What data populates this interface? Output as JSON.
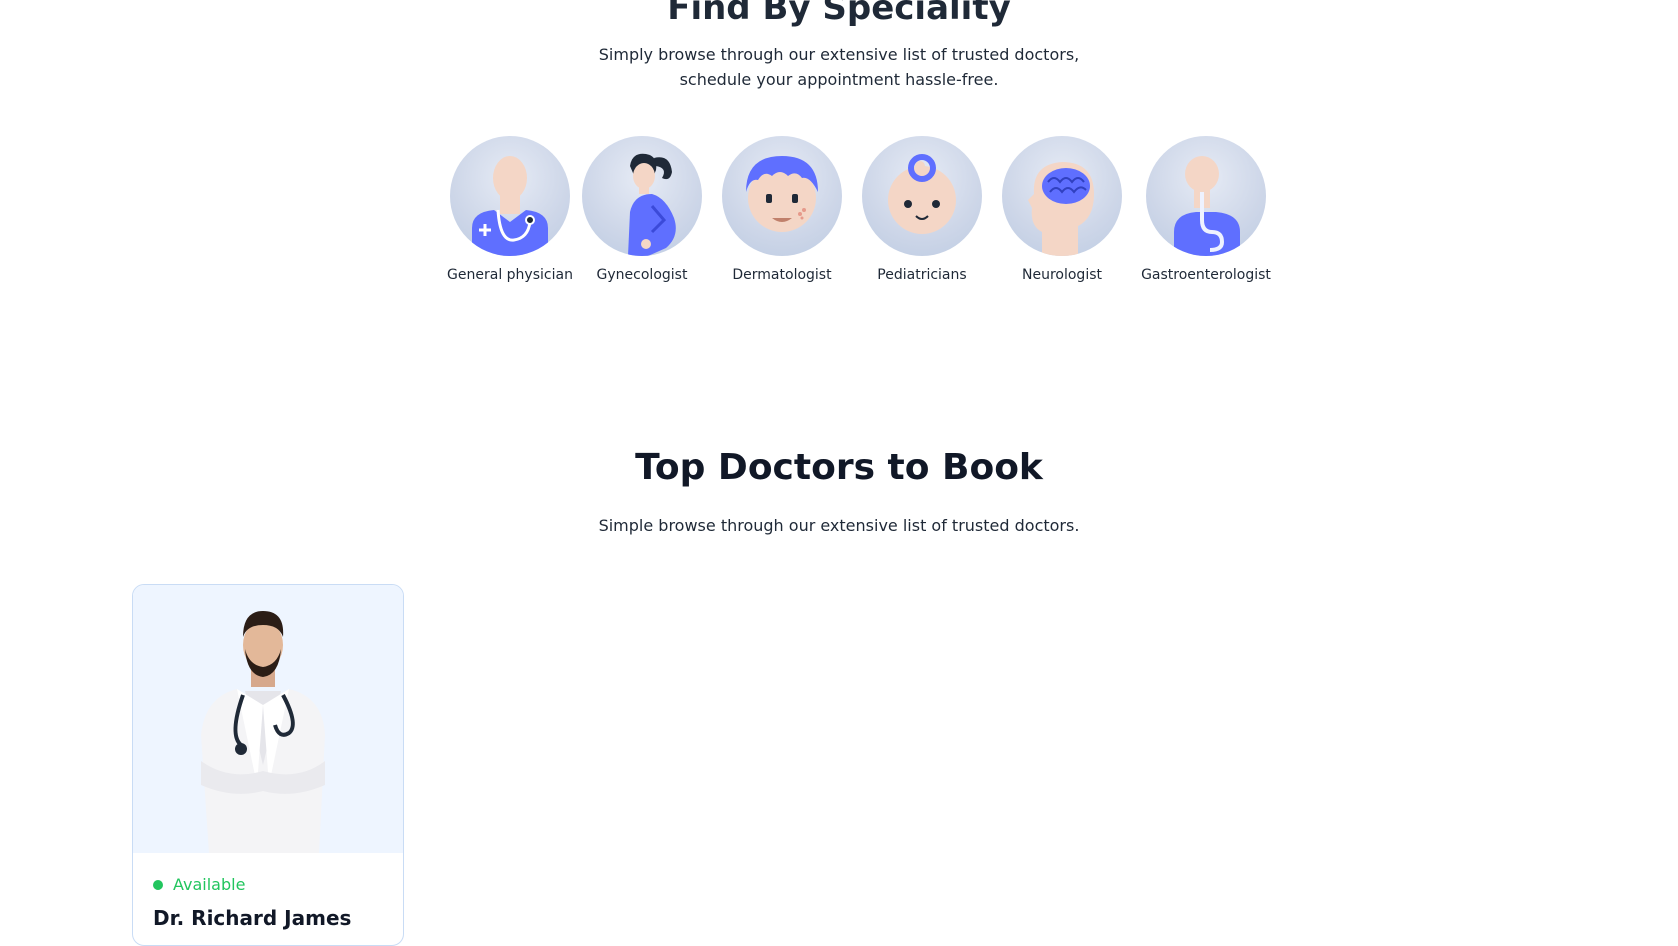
{
  "speciality": {
    "title": "Find By Speciality",
    "subtitle_line1": "Simply browse through our extensive list of trusted doctors,",
    "subtitle_line2": "schedule your appointment hassle-free.",
    "items": [
      {
        "label": "General physician",
        "icon": "general-physician-icon"
      },
      {
        "label": "Gynecologist",
        "icon": "gynecologist-icon"
      },
      {
        "label": "Dermatologist",
        "icon": "dermatologist-icon"
      },
      {
        "label": "Pediatricians",
        "icon": "pediatrician-icon"
      },
      {
        "label": "Neurologist",
        "icon": "neurologist-icon"
      },
      {
        "label": "Gastroenterologist",
        "icon": "gastroenterologist-icon"
      }
    ]
  },
  "top_doctors": {
    "title": "Top Doctors to Book",
    "subtitle": "Simple browse through our extensive list of trusted doctors.",
    "doctors": [
      {
        "status": "Available",
        "name": "Dr. Richard James"
      }
    ]
  },
  "colors": {
    "accent": "#5f6fff",
    "available": "#22c55e",
    "card_bg": "#eef5ff",
    "card_border": "#c9dcf5"
  }
}
